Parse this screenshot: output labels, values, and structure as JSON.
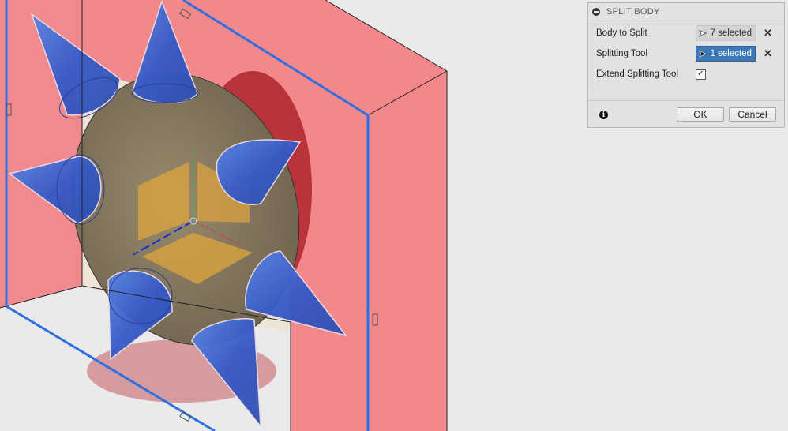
{
  "panel": {
    "title": "SPLIT BODY",
    "rows": [
      {
        "label": "Body to Split",
        "value": "7 selected"
      },
      {
        "label": "Splitting Tool",
        "value": "1 selected"
      },
      {
        "label": "Extend Splitting Tool",
        "checked": true
      }
    ],
    "ok_label": "OK",
    "cancel_label": "Cancel"
  },
  "icons": {
    "collapse": "collapse-icon",
    "cursor": "cursor-arrow-icon",
    "clear": "clear-x-icon",
    "check": "checkmark-icon",
    "info": "info-icon"
  },
  "glyphs": {
    "cursor": "➤",
    "clear": "✕",
    "check": "✓",
    "info": "i"
  },
  "colors": {
    "splitting_plane": "#f06d74",
    "selection_edge": "#2f6fe0",
    "cone": "#3f6fd4",
    "body": "#8b7a5f",
    "active_field": "#3c78b8"
  }
}
